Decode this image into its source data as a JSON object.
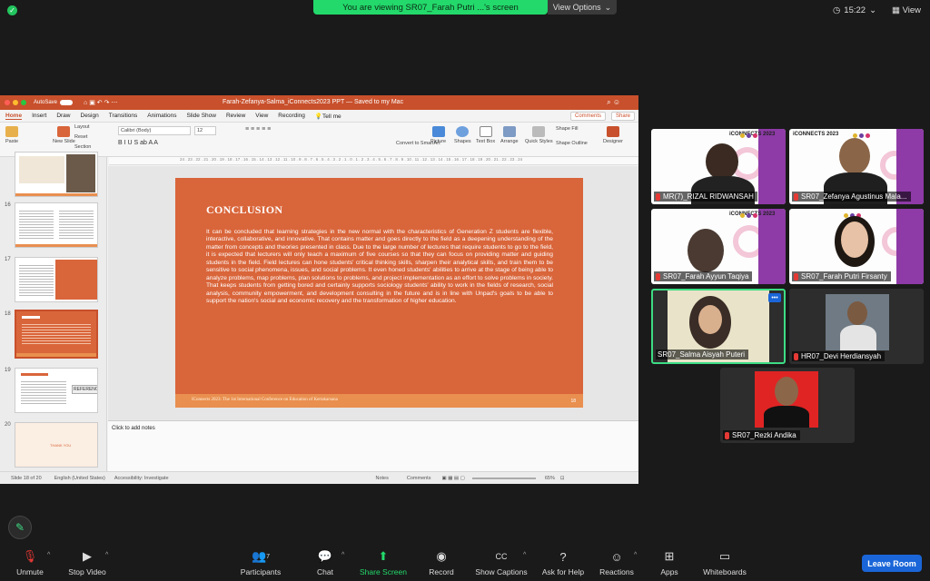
{
  "zoom": {
    "share_banner": "You are viewing SR07_Farah Putri ...'s screen",
    "view_options": "View Options",
    "clock": "15:22",
    "view_label": "View",
    "leave_label": "Leave Room",
    "toolbar": [
      {
        "id": "unmute",
        "label": "Unmute",
        "icon": "mic-off-icon"
      },
      {
        "id": "stop-video",
        "label": "Stop Video",
        "icon": "video-icon"
      },
      {
        "id": "participants",
        "label": "Participants",
        "icon": "participants-icon",
        "count": "7"
      },
      {
        "id": "chat",
        "label": "Chat",
        "icon": "chat-icon"
      },
      {
        "id": "share-screen",
        "label": "Share Screen",
        "icon": "share-screen-icon"
      },
      {
        "id": "record",
        "label": "Record",
        "icon": "record-icon"
      },
      {
        "id": "show-captions",
        "label": "Show Captions",
        "icon": "captions-icon"
      },
      {
        "id": "ask-help",
        "label": "Ask for Help",
        "icon": "help-icon"
      },
      {
        "id": "reactions",
        "label": "Reactions",
        "icon": "reactions-icon"
      },
      {
        "id": "apps",
        "label": "Apps",
        "icon": "apps-icon"
      },
      {
        "id": "whiteboards",
        "label": "Whiteboards",
        "icon": "whiteboard-icon"
      }
    ],
    "participants": [
      {
        "name": "MR(7)_RIZAL RIDWANSAH"
      },
      {
        "name": "SR07_Zefanya Agustinus Mala..."
      },
      {
        "name": "SR07_Farah Ayyun Taqiya"
      },
      {
        "name": "SR07_Farah Putri Firsanty"
      },
      {
        "name": "SR07_Salma Aisyah Puteri"
      },
      {
        "name": "HR07_Devi Herdiansyah"
      },
      {
        "name": "SR07_Rezki Andika"
      }
    ],
    "banner_brand": "iCONNECTS 2023"
  },
  "ppt": {
    "autosave": "AutoSave",
    "toggle_state": "OFF",
    "doc_title": "Farah-Zefanya-Salma_iConnects2023 PPT — Saved to my Mac",
    "tabs": [
      "Home",
      "Insert",
      "Draw",
      "Design",
      "Transitions",
      "Animations",
      "Slide Show",
      "Review",
      "View",
      "Recording",
      "Tell me"
    ],
    "comments": "Comments",
    "share": "Share",
    "ribbon": {
      "paste": "Paste",
      "new_slide": "New Slide",
      "layout": "Layout",
      "reset": "Reset",
      "section": "Section",
      "font": "Calibri (Body)",
      "size": "12",
      "convert": "Convert to SmartArt",
      "picture": "Picture",
      "shapes": "Shapes",
      "textbox": "Text Box",
      "arrange": "Arrange",
      "quick_styles": "Quick Styles",
      "shape_fill": "Shape Fill",
      "shape_outline": "Shape Outline",
      "designer": "Designer"
    },
    "ruler": "24 . 23 . 22 . 21 . 20 . 19 . 18 . 17 . 16 . 15 . 14 . 13 . 12 . 11 . 10 . 9 . 8 . 7 . 6 . 5 . 4 . 3 . 2 . 1 . 0 . 1 . 2 . 3 . 4 . 5 . 6 . 7 . 8 . 9 . 10 . 11 . 12 . 13 . 14 . 15 . 16 . 17 . 18 . 19 . 20 . 21 . 22 . 23 . 24",
    "thumb_nums": [
      "16",
      "17",
      "18",
      "19",
      "20"
    ],
    "thumb_labels": {
      "t19": "REFERENCES",
      "t20": "THANK YOU"
    },
    "slide": {
      "title": "CONCLUSION",
      "body": "It can be concluded that learning strategies in the new normal with the characteristics of Generation Z students are flexible, interactive, collaborative, and innovative. That contains matter and goes directly to the field as a deepening understanding of the matter from concepts and theories presented in class.  Due to the large number of lectures that require students to go to the field, it is expected that lecturers will only teach a maximum of five courses so that they can focus on providing matter and guiding students in the field. Field lectures can hone students' critical thinking skills, sharpen their analytical skills, and train them to be sensitive to social phenomena, issues, and social problems. It even honed students' abilities to arrive at the stage of being able to analyze problems, map problems, plan solutions to problems, and project implementation as an effort to solve problems in society. That keeps students from getting bored and certainly supports sociology students' ability to work in the fields of research, social analysis, community empowerment, and development consulting in the future and is in line with Unpad's goals to be able to support the nation's social and economic recovery and the transformation of higher education.",
      "footer": "IConnects 2023: The 1st International Conference on Education of Kertakarsana",
      "number": "18"
    },
    "notes_placeholder": "Click to add notes",
    "status": {
      "slide_of": "Slide 18 of 20",
      "language": "English (United States)",
      "accessibility": "Accessibility: Investigate",
      "notes": "Notes",
      "comments": "Comments",
      "zoom": "65%"
    }
  }
}
